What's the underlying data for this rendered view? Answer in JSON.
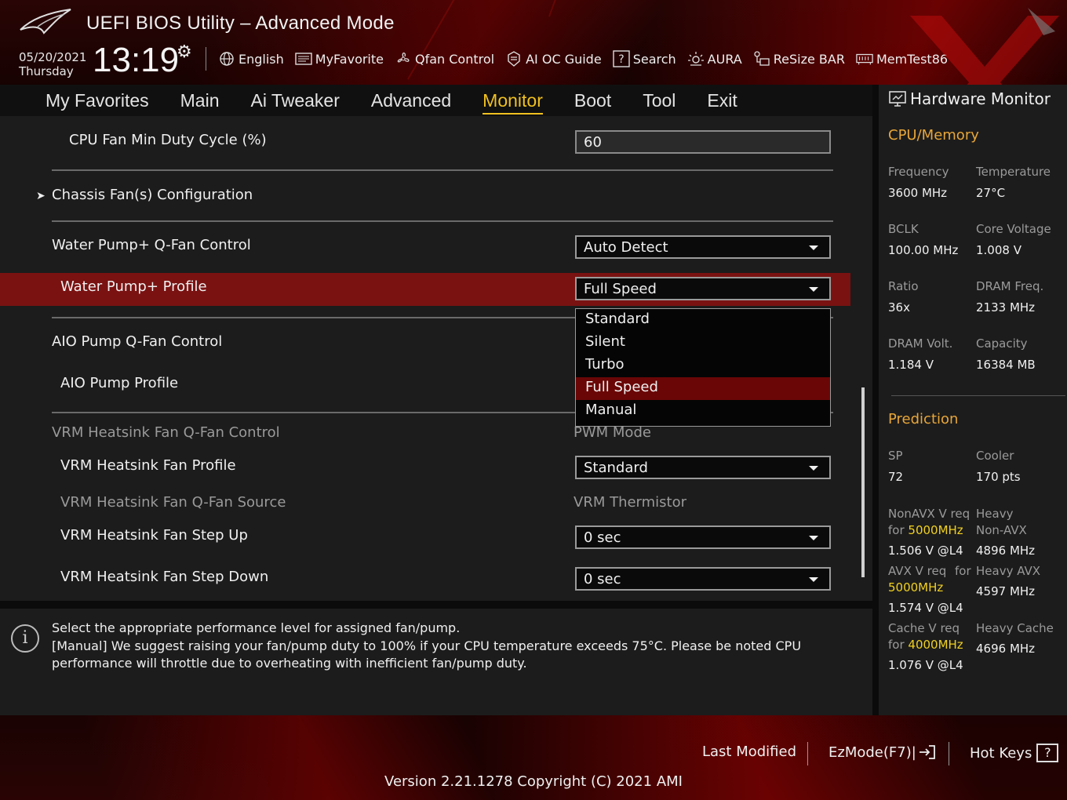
{
  "header": {
    "title": "UEFI BIOS Utility – Advanced Mode",
    "date": "05/20/2021",
    "weekday": "Thursday",
    "time": "13:19",
    "toolbar": [
      {
        "label": "English",
        "icon": "globe-icon"
      },
      {
        "label": "MyFavorite",
        "icon": "favorite-icon"
      },
      {
        "label": "Qfan Control",
        "icon": "fan-icon"
      },
      {
        "label": "AI OC Guide",
        "icon": "ai-guide-icon"
      },
      {
        "label": "Search",
        "icon": "search-icon"
      },
      {
        "label": "AURA",
        "icon": "aura-icon"
      },
      {
        "label": "ReSize BAR",
        "icon": "resize-bar-icon"
      },
      {
        "label": "MemTest86",
        "icon": "memtest-icon"
      }
    ]
  },
  "nav": {
    "tabs": [
      "My Favorites",
      "Main",
      "Ai Tweaker",
      "Advanced",
      "Monitor",
      "Boot",
      "Tool",
      "Exit"
    ],
    "active": "Monitor"
  },
  "settings": {
    "cpu_fan_min_duty": {
      "label": "CPU Fan Min Duty Cycle (%)",
      "value": "60"
    },
    "chassis_fans": {
      "label": "Chassis Fan(s) Configuration"
    },
    "water_pump_control": {
      "label": "Water Pump+ Q-Fan Control",
      "value": "Auto Detect"
    },
    "water_pump_profile": {
      "label": "Water Pump+ Profile",
      "value": "Full Speed"
    },
    "aio_pump_control": {
      "label": "AIO Pump Q-Fan Control"
    },
    "aio_pump_profile": {
      "label": "AIO Pump Profile"
    },
    "vrm_control": {
      "label": "VRM Heatsink Fan Q-Fan Control",
      "value": "PWM Mode"
    },
    "vrm_profile": {
      "label": "VRM Heatsink Fan Profile",
      "value": "Standard"
    },
    "vrm_source": {
      "label": "VRM Heatsink Fan Q-Fan Source",
      "value": "VRM Thermistor"
    },
    "vrm_step_up": {
      "label": "VRM Heatsink Fan Step Up",
      "value": "0 sec"
    },
    "vrm_step_down": {
      "label": "VRM Heatsink Fan Step Down",
      "value": "0 sec"
    }
  },
  "dropdown": {
    "options": [
      "Standard",
      "Silent",
      "Turbo",
      "Full Speed",
      "Manual"
    ],
    "selected": "Full Speed"
  },
  "help": {
    "line1": "Select the appropriate performance level for assigned fan/pump.",
    "line2": "[Manual] We suggest raising your fan/pump duty to 100% if your CPU temperature exceeds 75°C. Please be noted CPU performance will throttle due to overheating with inefficient fan/pump duty."
  },
  "hw": {
    "title": "Hardware Monitor",
    "cpu_section": "CPU/Memory",
    "frequency_label": "Frequency",
    "frequency": "3600 MHz",
    "temperature_label": "Temperature",
    "temperature": "27°C",
    "bclk_label": "BCLK",
    "bclk": "100.00 MHz",
    "core_voltage_label": "Core Voltage",
    "core_voltage": "1.008 V",
    "ratio_label": "Ratio",
    "ratio": "36x",
    "dram_freq_label": "DRAM Freq.",
    "dram_freq": "2133 MHz",
    "dram_volt_label": "DRAM Volt.",
    "dram_volt": "1.184 V",
    "capacity_label": "Capacity",
    "capacity": "16384 MB",
    "prediction_section": "Prediction",
    "sp_label": "SP",
    "sp": "72",
    "cooler_label": "Cooler",
    "cooler": "170 pts",
    "nonavx_label": "NonAVX V req",
    "nonavx_for": "for",
    "nonavx_freq": "5000MHz",
    "nonavx_value": "1.506 V @L4",
    "heavy_nonavx_label1": "Heavy",
    "heavy_nonavx_label2": "Non-AVX",
    "heavy_nonavx_value": "4896 MHz",
    "avx_label": "AVX V req",
    "avx_for": "for",
    "avx_freq": "5000MHz",
    "avx_value": "1.574 V @L4",
    "heavy_avx_label": "Heavy AVX",
    "heavy_avx_value": "4597 MHz",
    "cache_label": "Cache V req",
    "cache_for": "for",
    "cache_freq": "4000MHz",
    "cache_value": "1.076 V @L4",
    "heavy_cache_label": "Heavy Cache",
    "heavy_cache_value": "4696 MHz"
  },
  "footer": {
    "last_modified": "Last Modified",
    "ezmode": "EzMode(F7)|",
    "hotkeys": "Hot Keys",
    "hotkeys_key": "?",
    "version": "Version 2.21.1278 Copyright (C) 2021 AMI"
  },
  "colors": {
    "accent": "#f0c020",
    "highlight_row": "#7a1212",
    "section_title": "#e8a638",
    "frequency_highlight": "#f0d020"
  }
}
